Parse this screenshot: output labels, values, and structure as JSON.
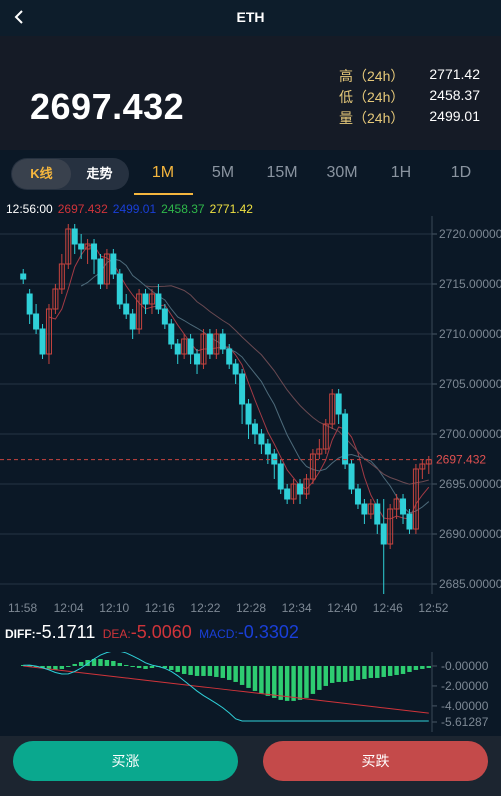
{
  "header": {
    "title": "ETH",
    "back_icon": "chevron-left-icon"
  },
  "price": {
    "last": "2697.432",
    "stats": [
      {
        "label": "高（24h）",
        "value": "2771.42"
      },
      {
        "label": "低（24h）",
        "value": "2458.37"
      },
      {
        "label": "量（24h）",
        "value": "2499.01"
      }
    ]
  },
  "tabs": {
    "kline": "K线",
    "trend": "走势",
    "intervals": [
      "1M",
      "5M",
      "15M",
      "30M",
      "1H",
      "1D"
    ],
    "active_interval": "1M"
  },
  "ohlc_legend": {
    "time": "12:56:00",
    "open": "2697.432",
    "high": "2499.01",
    "low": "2458.37",
    "close": "2771.42"
  },
  "colors": {
    "up": "#c7443f",
    "down": "#2fd0d8",
    "accent": "#f5b63e",
    "buy": "#0aa88e",
    "sell": "#c44a4a",
    "macd_bar": "#2ecc71"
  },
  "chart_data": [
    {
      "type": "candlestick",
      "title": "",
      "ylim": [
        2684,
        2721
      ],
      "y_ticks": [
        "2720.00000",
        "2715.00000",
        "2710.00000",
        "2705.00000",
        "2700.00000",
        "2695.00000",
        "2690.00000",
        "2685.00000"
      ],
      "x_ticks": [
        "11:58",
        "12:04",
        "12:10",
        "12:16",
        "12:22",
        "12:28",
        "12:34",
        "12:40",
        "12:46",
        "12:52"
      ],
      "last_price_label": "2697.432",
      "candles": [
        [
          2716.0,
          2715.5,
          2716.5,
          2715.0
        ],
        [
          2714.0,
          2712.0,
          2714.5,
          2711.0
        ],
        [
          2712.0,
          2710.5,
          2713.0,
          2710.0
        ],
        [
          2710.5,
          2708.0,
          2711.0,
          2707.5
        ],
        [
          2708.0,
          2712.5,
          2713.0,
          2707.0
        ],
        [
          2712.5,
          2714.5,
          2715.0,
          2712.0
        ],
        [
          2714.5,
          2717.0,
          2718.0,
          2714.0
        ],
        [
          2717.0,
          2720.5,
          2721.0,
          2716.5
        ],
        [
          2720.5,
          2719.0,
          2721.0,
          2718.0
        ],
        [
          2719.0,
          2718.5,
          2720.0,
          2717.5
        ],
        [
          2718.5,
          2719.0,
          2719.5,
          2717.0
        ],
        [
          2719.0,
          2717.5,
          2719.5,
          2716.0
        ],
        [
          2717.5,
          2715.0,
          2718.0,
          2714.5
        ],
        [
          2715.0,
          2718.0,
          2718.5,
          2714.5
        ],
        [
          2718.0,
          2716.0,
          2718.5,
          2715.5
        ],
        [
          2716.0,
          2713.0,
          2716.5,
          2712.5
        ],
        [
          2713.0,
          2712.0,
          2714.0,
          2711.5
        ],
        [
          2712.0,
          2710.5,
          2712.5,
          2709.5
        ],
        [
          2710.5,
          2714.0,
          2714.5,
          2710.0
        ],
        [
          2714.0,
          2713.0,
          2714.5,
          2712.0
        ],
        [
          2713.0,
          2714.0,
          2714.5,
          2712.0
        ],
        [
          2714.0,
          2712.5,
          2715.0,
          2712.0
        ],
        [
          2712.5,
          2711.0,
          2713.0,
          2710.5
        ],
        [
          2711.0,
          2709.0,
          2711.5,
          2708.5
        ],
        [
          2709.0,
          2708.0,
          2709.5,
          2707.0
        ],
        [
          2708.0,
          2709.5,
          2710.0,
          2707.5
        ],
        [
          2709.5,
          2708.0,
          2710.0,
          2707.0
        ],
        [
          2708.0,
          2707.0,
          2708.5,
          2706.0
        ],
        [
          2707.0,
          2710.0,
          2710.5,
          2706.5
        ],
        [
          2710.0,
          2708.0,
          2710.5,
          2707.5
        ],
        [
          2708.0,
          2710.0,
          2710.5,
          2707.5
        ],
        [
          2710.0,
          2708.5,
          2710.5,
          2708.0
        ],
        [
          2708.5,
          2707.0,
          2709.0,
          2706.5
        ],
        [
          2707.0,
          2706.0,
          2707.5,
          2705.0
        ],
        [
          2706.0,
          2703.0,
          2706.5,
          2701.0
        ],
        [
          2703.0,
          2701.0,
          2703.5,
          2699.5
        ],
        [
          2701.0,
          2700.0,
          2701.5,
          2699.0
        ],
        [
          2700.0,
          2699.0,
          2700.5,
          2698.0
        ],
        [
          2699.0,
          2698.0,
          2699.5,
          2697.0
        ],
        [
          2698.0,
          2697.0,
          2698.5,
          2695.5
        ],
        [
          2697.0,
          2694.5,
          2697.5,
          2694.0
        ],
        [
          2694.5,
          2693.5,
          2695.0,
          2693.0
        ],
        [
          2693.5,
          2695.0,
          2695.5,
          2693.0
        ],
        [
          2695.0,
          2694.0,
          2695.5,
          2693.0
        ],
        [
          2694.0,
          2695.5,
          2696.0,
          2693.5
        ],
        [
          2695.5,
          2698.0,
          2698.5,
          2695.0
        ],
        [
          2698.0,
          2698.5,
          2699.5,
          2697.5
        ],
        [
          2698.5,
          2701.0,
          2701.5,
          2698.0
        ],
        [
          2701.0,
          2704.0,
          2704.5,
          2700.5
        ],
        [
          2704.0,
          2702.0,
          2704.5,
          2701.0
        ],
        [
          2702.0,
          2697.0,
          2702.5,
          2696.5
        ],
        [
          2697.0,
          2694.5,
          2697.5,
          2694.0
        ],
        [
          2694.5,
          2693.0,
          2695.0,
          2692.5
        ],
        [
          2693.0,
          2692.0,
          2693.5,
          2691.0
        ],
        [
          2692.0,
          2693.0,
          2693.5,
          2691.5
        ],
        [
          2693.0,
          2691.0,
          2693.5,
          2690.0
        ],
        [
          2691.0,
          2689.0,
          2693.5,
          2684.0
        ],
        [
          2689.0,
          2692.5,
          2693.0,
          2688.5
        ],
        [
          2692.5,
          2693.5,
          2694.0,
          2691.5
        ],
        [
          2693.5,
          2692.0,
          2694.0,
          2691.0
        ],
        [
          2692.0,
          2690.5,
          2692.5,
          2690.0
        ],
        [
          2690.5,
          2696.5,
          2697.0,
          2690.0
        ],
        [
          2696.5,
          2697.0,
          2697.5,
          2695.5
        ],
        [
          2697.0,
          2697.432,
          2697.8,
          2696.0
        ]
      ]
    },
    {
      "type": "macd",
      "title": "",
      "diff_label": "DIFF:",
      "diff": "-5.1711",
      "dea_label": "DEA:",
      "dea": "-5.0060",
      "macd_label": "MACD:",
      "macd": "-0.3302",
      "ylim": [
        -5.61287,
        0.8
      ],
      "y_ticks": [
        "-0.00000",
        "-2.00000",
        "-4.00000",
        "-5.61287"
      ],
      "histogram": [
        0.1,
        0.05,
        -0.1,
        -0.2,
        -0.3,
        -0.4,
        -0.3,
        -0.1,
        0.2,
        0.4,
        0.6,
        0.7,
        0.7,
        0.6,
        0.5,
        0.3,
        0.1,
        -0.1,
        -0.2,
        -0.3,
        -0.2,
        -0.1,
        -0.2,
        -0.4,
        -0.6,
        -0.8,
        -0.9,
        -1.0,
        -1.0,
        -1.0,
        -1.1,
        -1.2,
        -1.4,
        -1.6,
        -1.9,
        -2.2,
        -2.5,
        -2.8,
        -3.0,
        -3.2,
        -3.4,
        -3.5,
        -3.5,
        -3.4,
        -3.2,
        -2.8,
        -2.4,
        -2.0,
        -1.7,
        -1.6,
        -1.6,
        -1.5,
        -1.4,
        -1.3,
        -1.2,
        -1.2,
        -1.1,
        -1.0,
        -0.9,
        -0.8,
        -0.6,
        -0.4,
        -0.3,
        -0.2
      ]
    }
  ],
  "actions": {
    "buy_up": "买涨",
    "buy_down": "买跌"
  }
}
